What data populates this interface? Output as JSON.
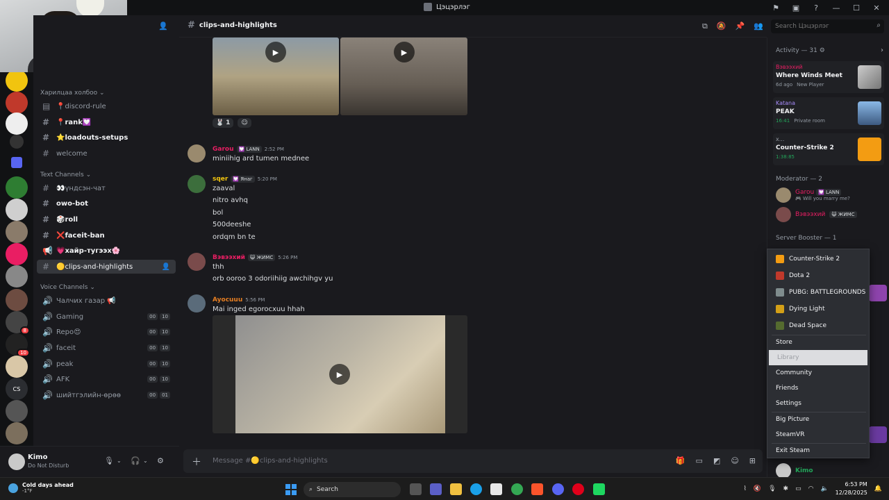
{
  "titlebar": {
    "title": "Цэцэрлэг"
  },
  "sidebar": {
    "categories": {
      "links": "Харилцаа холбоо",
      "text": "Text Channels",
      "voice": "Voice Channels"
    },
    "channels": [
      {
        "label": "📍discord-rule"
      },
      {
        "label": "📍rank💟"
      },
      {
        "label": "⭐loadouts-setups"
      },
      {
        "label": "welcome"
      },
      {
        "label": "👀үндсэн-чат"
      },
      {
        "label": "owo-bot"
      },
      {
        "label": "🎲roll"
      },
      {
        "label": "❌faceit-ban"
      },
      {
        "label": "💗хайр-тугээх🌸"
      },
      {
        "label": "🟡clips-and-highlights"
      }
    ],
    "voice": [
      {
        "label": "Чалчих газар 📢"
      },
      {
        "label": "Gaming",
        "a": "00",
        "b": "10"
      },
      {
        "label": "Repo😍",
        "a": "00",
        "b": "10"
      },
      {
        "label": "faceit",
        "a": "00",
        "b": "10"
      },
      {
        "label": "peak",
        "a": "00",
        "b": "10"
      },
      {
        "label": "AFK",
        "a": "00",
        "b": "10"
      },
      {
        "label": "шийтгэлийн-өрөө",
        "a": "00",
        "b": "01"
      }
    ]
  },
  "user": {
    "name": "Kimo",
    "status": "Do Not Disturb"
  },
  "chat": {
    "channel_title": "clips-and-highlights",
    "reaction_count": "1",
    "messages": [
      {
        "author": "Garou",
        "tag": "💟 LANN",
        "time": "2:52 PM",
        "lines": [
          "miniihig ard tumen mednee"
        ]
      },
      {
        "author": "sqer",
        "tag": "💟 Янаг",
        "time": "5:20 PM",
        "lines": [
          "zaaval",
          "nitro avhq",
          "bol",
          "500deeshe",
          "ordqm bn te"
        ]
      },
      {
        "author": "Вэвээхий",
        "tag": "😺 ЖИМС",
        "time": "5:26 PM",
        "lines": [
          "thh",
          "orb ooroo 3 odoriihiig awchihgv yu"
        ]
      },
      {
        "author": "Ayocuuu",
        "tag": "",
        "time": "5:56 PM",
        "lines": [
          "Mai inged egorocxuu hhah"
        ]
      }
    ],
    "composer_placeholder": "Message #🟡clips-and-highlights"
  },
  "search": {
    "placeholder": "Search Цэцэрлэг"
  },
  "activity": {
    "header": "Activity — 31 ⚙",
    "cards": [
      {
        "user": "Вэвээхий",
        "game": "Where Winds Meet",
        "elapsed": "6d ago",
        "detail": "New Player"
      },
      {
        "user": "Katana",
        "game": "PEAK",
        "elapsed": "16:41",
        "detail": "Private room"
      },
      {
        "user": "x...",
        "game": "Counter-Strike 2",
        "elapsed": "1:38:85",
        "detail": ""
      }
    ],
    "moderator_header": "Moderator — 2",
    "moderators": [
      {
        "name": "Garou",
        "tag": "💟 LANN",
        "status": "🎮 Will you marry me?"
      },
      {
        "name": "Вэвээхий",
        "tag": "😺 ЖИМС",
        "status": ""
      }
    ],
    "booster_header": "Server Booster — 1",
    "bottom_member": "Kimo"
  },
  "steam_menu": {
    "games": [
      "Counter-Strike 2",
      "Dota 2",
      "PUBG: BATTLEGROUNDS",
      "Dying Light",
      "Dead Space"
    ],
    "items": [
      "Store",
      "Library",
      "Community",
      "Friends",
      "Settings",
      "Big Picture",
      "SteamVR",
      "Exit Steam"
    ]
  },
  "taskbar": {
    "weather_title": "Cold days ahead",
    "weather_temp": "-1°F",
    "search_label": "Search",
    "time": "6:53 PM",
    "date": "12/28/2025"
  },
  "colors": {
    "accent": "#5865f2",
    "dnd": "#f23f43",
    "online": "#23a55a"
  }
}
